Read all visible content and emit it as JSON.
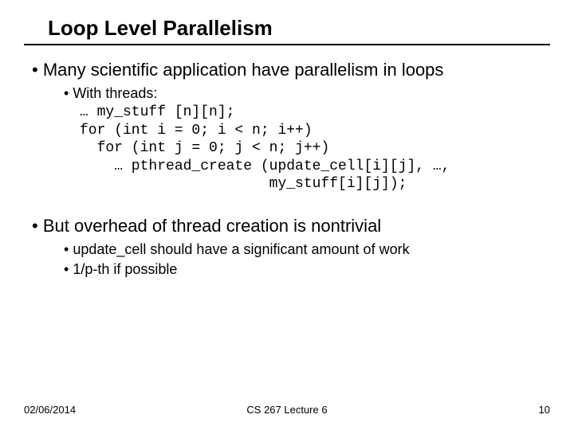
{
  "title": "Loop Level Parallelism",
  "bullets": {
    "main1": "Many scientific application have parallelism in loops",
    "sub1": "With threads:",
    "code1": "… my_stuff [n][n];",
    "code2": "for (int i = 0; i < n; i++)",
    "code3": "  for (int j = 0; j < n; j++)",
    "code4": "    … pthread_create (update_cell[i][j], …,",
    "code5": "                      my_stuff[i][j]);",
    "main2": "But overhead of thread creation is nontrivial",
    "sub2": "update_cell should have a significant amount of work",
    "sub3": "1/p-th if possible"
  },
  "footer": {
    "date": "02/06/2014",
    "center": "CS 267 Lecture 6",
    "page": "10"
  }
}
